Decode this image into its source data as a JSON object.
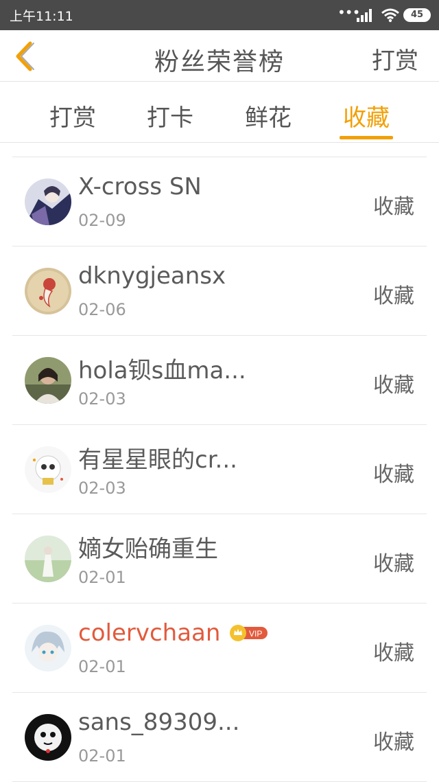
{
  "status_bar": {
    "time": "上午11:11",
    "battery": "45"
  },
  "nav": {
    "title": "粉丝荣誉榜",
    "action": "打赏"
  },
  "tabs": [
    {
      "label": "打赏",
      "active": false
    },
    {
      "label": "打卡",
      "active": false
    },
    {
      "label": "鲜花",
      "active": false
    },
    {
      "label": "收藏",
      "active": true
    }
  ],
  "accent_color": "#f2a007",
  "vip_name_color": "#e25a3c",
  "list": [
    {
      "name": "X-cross SN",
      "date": "02-09",
      "action": "收藏",
      "vip": false
    },
    {
      "name": "dknygjeansx",
      "date": "02-06",
      "action": "收藏",
      "vip": false
    },
    {
      "name": "hola钡s血ma...",
      "date": "02-03",
      "action": "收藏",
      "vip": false
    },
    {
      "name": "有星星眼的cr...",
      "date": "02-03",
      "action": "收藏",
      "vip": false
    },
    {
      "name": "嫡女贻确重生",
      "date": "02-01",
      "action": "收藏",
      "vip": false
    },
    {
      "name": "colervchaan",
      "date": "02-01",
      "action": "收藏",
      "vip": true,
      "badge": "VIP"
    },
    {
      "name": "sans_89309...",
      "date": "02-01",
      "action": "收藏",
      "vip": false
    }
  ]
}
